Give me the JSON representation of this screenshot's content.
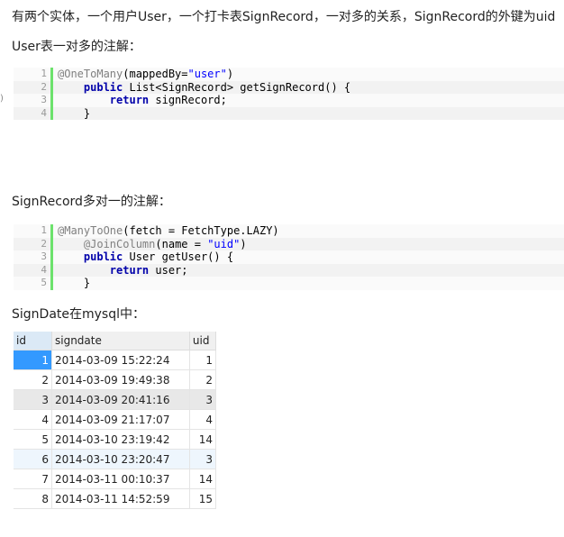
{
  "intro": "有两个实体，一个用户User，一个打卡表SignRecord，一对多的关系，SignRecord的外键为uid",
  "section1_title": "User表一对多的注解：",
  "code1": [
    {
      "line": "1",
      "parts": [
        {
          "t": "@OneToMany",
          "c": "ann"
        },
        {
          "t": "(mappedBy=",
          "c": ""
        },
        {
          "t": "\"user\"",
          "c": "str"
        },
        {
          "t": ")",
          "c": ""
        }
      ]
    },
    {
      "line": "2",
      "parts": [
        {
          "t": "    ",
          "c": ""
        },
        {
          "t": "public",
          "c": "kw"
        },
        {
          "t": " List<SignRecord> getSignRecord() {",
          "c": ""
        }
      ]
    },
    {
      "line": "3",
      "parts": [
        {
          "t": "        ",
          "c": ""
        },
        {
          "t": "return",
          "c": "kw"
        },
        {
          "t": " signRecord;",
          "c": ""
        }
      ]
    },
    {
      "line": "4",
      "parts": [
        {
          "t": "    }",
          "c": ""
        }
      ]
    }
  ],
  "stray_mark": ")",
  "section2_title": "SignRecord多对一的注解：",
  "code2": [
    {
      "line": "1",
      "parts": [
        {
          "t": "@ManyToOne",
          "c": "ann"
        },
        {
          "t": "(fetch = FetchType.LAZY)",
          "c": ""
        }
      ]
    },
    {
      "line": "2",
      "parts": [
        {
          "t": "    ",
          "c": ""
        },
        {
          "t": "@JoinColumn",
          "c": "ann"
        },
        {
          "t": "(name = ",
          "c": ""
        },
        {
          "t": "\"uid\"",
          "c": "str"
        },
        {
          "t": ")",
          "c": ""
        }
      ]
    },
    {
      "line": "3",
      "parts": [
        {
          "t": "    ",
          "c": ""
        },
        {
          "t": "public",
          "c": "kw"
        },
        {
          "t": " User getUser() {",
          "c": ""
        }
      ]
    },
    {
      "line": "4",
      "parts": [
        {
          "t": "        ",
          "c": ""
        },
        {
          "t": "return",
          "c": "kw"
        },
        {
          "t": " user;",
          "c": ""
        }
      ]
    },
    {
      "line": "5",
      "parts": [
        {
          "t": "    }",
          "c": ""
        }
      ]
    }
  ],
  "section3_title": "SignDate在mysql中：",
  "table": {
    "columns": [
      "id",
      "signdate",
      "uid"
    ],
    "rows": [
      [
        "1",
        "2014-03-09 15:22:24",
        "1"
      ],
      [
        "2",
        "2014-03-09 19:49:38",
        "2"
      ],
      [
        "3",
        "2014-03-09 20:41:16",
        "3"
      ],
      [
        "4",
        "2014-03-09 21:17:07",
        "4"
      ],
      [
        "5",
        "2014-03-10 23:19:42",
        "14"
      ],
      [
        "6",
        "2014-03-10 23:20:47",
        "3"
      ],
      [
        "7",
        "2014-03-11 00:10:37",
        "14"
      ],
      [
        "8",
        "2014-03-11 14:52:59",
        "15"
      ]
    ]
  },
  "colors": {
    "gutter_bar": "#6ce26c",
    "keyword": "#0000aa",
    "annotation": "#808080",
    "string": "#0000ff",
    "selected_cell": "#3399ff"
  }
}
